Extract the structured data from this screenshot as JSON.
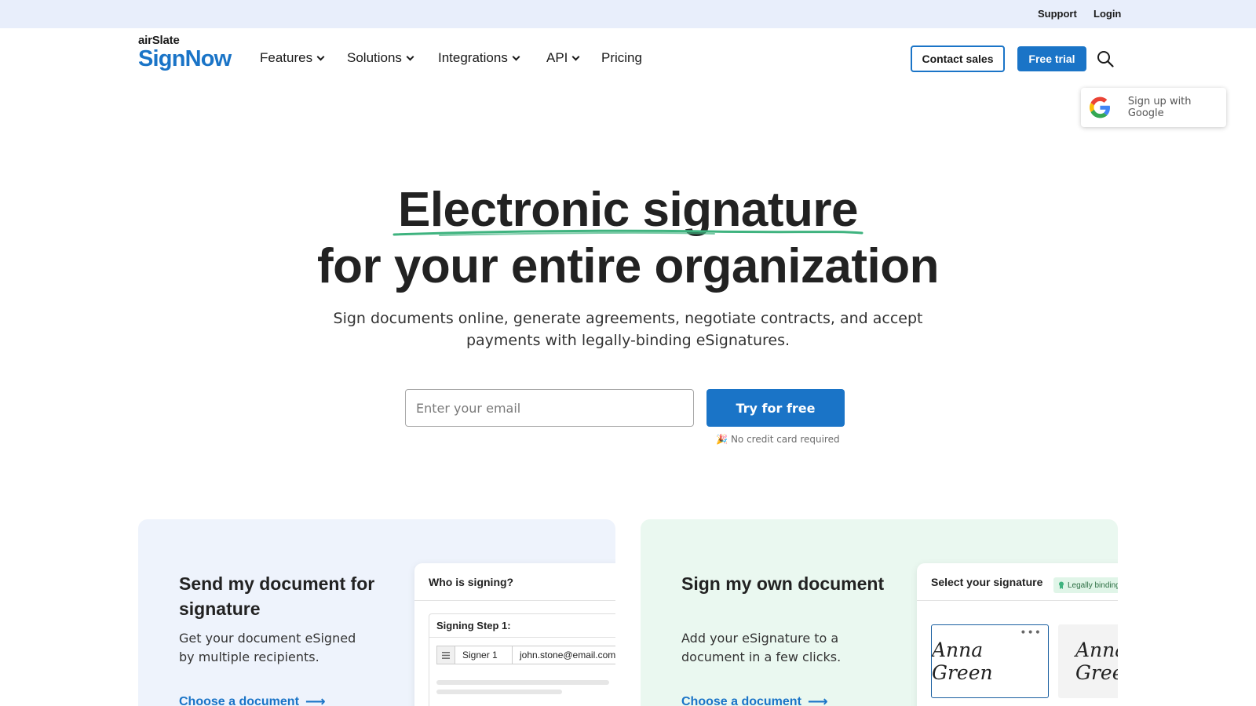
{
  "utility_bar": {
    "support": "Support",
    "login": "Login"
  },
  "logo": {
    "small": "airSlate",
    "big": "SignNow"
  },
  "nav": {
    "items": [
      {
        "label": "Features",
        "has_dropdown": true
      },
      {
        "label": "Solutions",
        "has_dropdown": true
      },
      {
        "label": "Integrations",
        "has_dropdown": true
      },
      {
        "label": "API",
        "has_dropdown": true
      },
      {
        "label": "Pricing",
        "has_dropdown": false
      }
    ],
    "contact_sales": "Contact sales",
    "free_trial": "Free trial",
    "search_icon": "search-icon"
  },
  "google_popup": {
    "label": "Sign up with Google",
    "icon": "google-icon"
  },
  "hero": {
    "title_line1": "Electronic signature",
    "title_line2": "for your entire organization",
    "subtitle": "Sign documents online, generate agreements, negotiate contracts, and accept payments with legally-binding eSignatures.",
    "email_placeholder": "Enter your email",
    "cta": "Try for free",
    "note_emoji": "🎉",
    "note": "No credit card required",
    "accent_color": "#3fb37f"
  },
  "cards": {
    "send": {
      "title": "Send my document for signature",
      "description": "Get your document eSigned by multiple recipients.",
      "link": "Choose a document",
      "panel": {
        "title": "Who is signing?",
        "step_label": "Signing Step 1:",
        "signer": "Signer 1",
        "email": "john.stone@email.com"
      }
    },
    "own": {
      "title": "Sign my own document",
      "description": "Add your eSignature to a document in a few clicks.",
      "link": "Choose a document",
      "panel": {
        "title": "Select your signature",
        "badge": "Legally binding",
        "signature_1": "Anna Green",
        "signature_2": "Anna Green",
        "more_icon": "more-dots-icon"
      }
    }
  },
  "colors": {
    "brand_blue": "#1a74c7",
    "utility_bg": "#e8eefb",
    "card_left_bg": "#eef3fc",
    "card_right_bg": "#eaf8f0"
  }
}
